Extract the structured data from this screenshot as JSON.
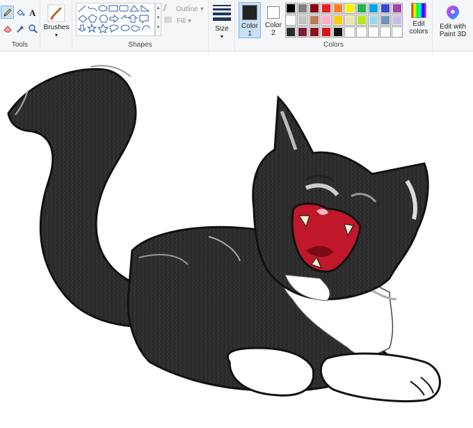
{
  "groups": {
    "tools_label": "Tools",
    "shapes_label": "Shapes",
    "colors_label": "Colors"
  },
  "brushes_label": "Brushes",
  "outline_label": "Outline",
  "fill_label": "Fill",
  "size_label": "Size",
  "color1": {
    "line1": "Color",
    "line2": "1",
    "value": "#222222"
  },
  "color2": {
    "line1": "Color",
    "line2": "2",
    "value": "#ffffff"
  },
  "edit_colors": {
    "line1": "Edit",
    "line2": "colors"
  },
  "paint3d": {
    "line1": "Edit with",
    "line2": "Paint 3D"
  },
  "palette_row1": [
    "#000000",
    "#7f7f7f",
    "#880015",
    "#ed1c24",
    "#ff7f27",
    "#fff200",
    "#22b14c",
    "#00a2e8",
    "#3f48cc",
    "#a349a4"
  ],
  "palette_row2": [
    "#ffffff",
    "#c3c3c3",
    "#b97a57",
    "#ffaec9",
    "#ffc90e",
    "#efe4b0",
    "#b5e61d",
    "#99d9ea",
    "#7092be",
    "#c8bfe7"
  ],
  "palette_row3": [
    "#2b2b2b",
    "#7a1f33",
    "#8f0f1c",
    "#d2141c",
    "#111111",
    "#ffffff",
    "#ffffff",
    "#ffffff",
    "#ffffff",
    "#ffffff"
  ]
}
